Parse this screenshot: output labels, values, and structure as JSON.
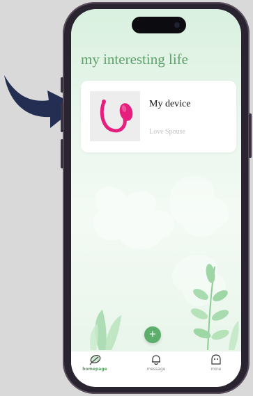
{
  "app": {
    "title": "my interesting life"
  },
  "device_card": {
    "name": "My device",
    "subtitle": "Love Spouse"
  },
  "fab": {
    "icon": "plus-icon",
    "label": "+"
  },
  "tabs": [
    {
      "label": "homepage",
      "icon": "leaf-icon",
      "active": true
    },
    {
      "label": "message",
      "icon": "bell-icon",
      "active": false
    },
    {
      "label": "mine",
      "icon": "face-icon",
      "active": false
    }
  ],
  "colors": {
    "accent": "#5fa06a",
    "arrow": "#232e52",
    "device": "#e61f7e"
  }
}
